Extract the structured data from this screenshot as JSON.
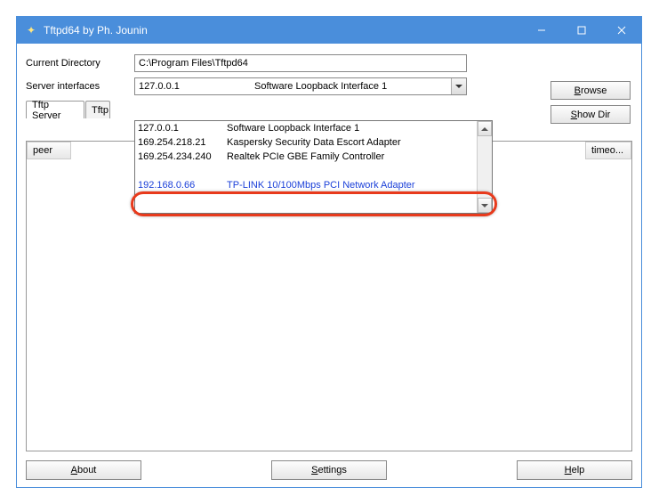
{
  "window": {
    "title": "Tftpd64 by Ph. Jounin"
  },
  "labels": {
    "current_directory": "Current Directory",
    "server_interfaces": "Server interfaces"
  },
  "fields": {
    "current_directory": "C:\\Program Files\\Tftpd64",
    "selected_interface_ip": "127.0.0.1",
    "selected_interface_name": "Software Loopback Interface 1"
  },
  "buttons": {
    "browse": "Browse",
    "show_dir": "Show Dir",
    "about": "About",
    "settings": "Settings",
    "help": "Help"
  },
  "tabs": {
    "t1": "Tftp Server",
    "t2": "Tftp"
  },
  "list_headers": {
    "left": "peer",
    "right": "timeo..."
  },
  "dropdown": {
    "items": [
      {
        "ip": "127.0.0.1",
        "name": "Software Loopback Interface 1"
      },
      {
        "ip": "169.254.218.21",
        "name": "Kaspersky Security Data Escort Adapter"
      },
      {
        "ip": "169.254.234.240",
        "name": "Realtek PCIe GBE Family Controller"
      }
    ],
    "partial_ip": "",
    "partial_name": "",
    "highlighted": {
      "ip": "192.168.0.66",
      "name": "TP-LINK 10/100Mbps PCI Network Adapter"
    }
  }
}
